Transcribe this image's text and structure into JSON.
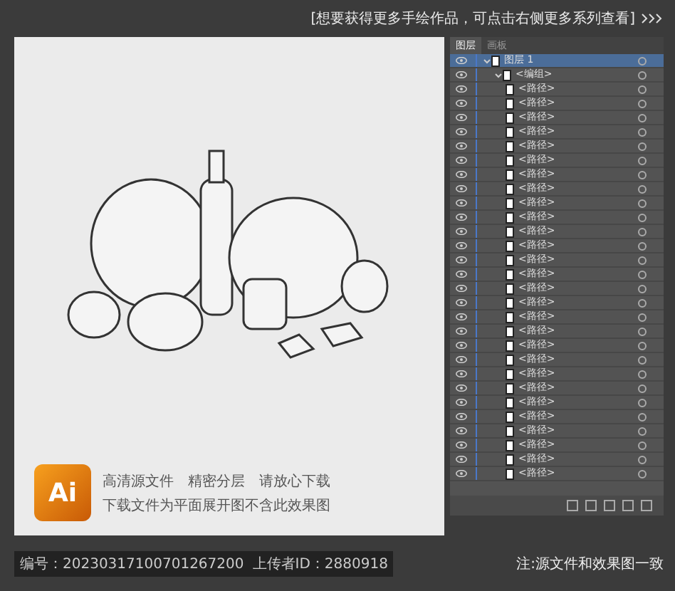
{
  "banner": {
    "text": "[想要获得更多手绘作品，可点击右侧更多系列查看]"
  },
  "panel": {
    "tabs": [
      {
        "label": "图层",
        "selected": true
      },
      {
        "label": "画板",
        "selected": false
      }
    ],
    "layers": [
      {
        "name": "图层 1",
        "expanded": true,
        "selected": true,
        "children": [
          {
            "name": "<编组>",
            "expanded": true,
            "selected": false,
            "children": [
              {
                "name": "<路径>"
              },
              {
                "name": "<路径>"
              },
              {
                "name": "<路径>"
              },
              {
                "name": "<路径>"
              },
              {
                "name": "<路径>"
              },
              {
                "name": "<路径>"
              },
              {
                "name": "<路径>"
              },
              {
                "name": "<路径>"
              },
              {
                "name": "<路径>"
              },
              {
                "name": "<路径>"
              },
              {
                "name": "<路径>"
              },
              {
                "name": "<路径>"
              },
              {
                "name": "<路径>"
              },
              {
                "name": "<路径>"
              },
              {
                "name": "<路径>"
              },
              {
                "name": "<路径>"
              },
              {
                "name": "<路径>"
              },
              {
                "name": "<路径>"
              },
              {
                "name": "<路径>"
              },
              {
                "name": "<路径>"
              },
              {
                "name": "<路径>"
              },
              {
                "name": "<路径>"
              },
              {
                "name": "<路径>"
              },
              {
                "name": "<路径>"
              },
              {
                "name": "<路径>"
              },
              {
                "name": "<路径>"
              },
              {
                "name": "<路径>"
              },
              {
                "name": "<路径>"
              }
            ]
          }
        ]
      }
    ]
  },
  "promo": {
    "logo": "Ai",
    "lines": [
      "高清源文件　精密分层　请放心下载",
      "下载文件为平面展开图不含此效果图"
    ]
  },
  "footer": {
    "id": "编号：20230317100701267200",
    "uploader": "上传者ID：2880918",
    "note": "注:源文件和效果图一致"
  }
}
